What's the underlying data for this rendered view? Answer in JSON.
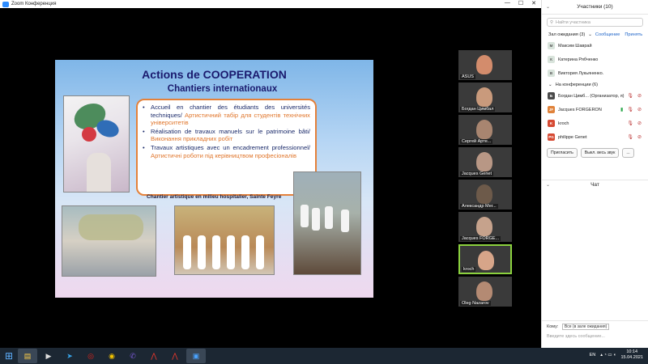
{
  "window": {
    "title": "Zoom Конференция",
    "minimize": "—",
    "maximize": "☐",
    "close": "✕"
  },
  "slide": {
    "title": "Actions de COOPERATION",
    "subtitle": "Chantiers internationaux",
    "bullets": [
      {
        "fr": "Accueil en chantier des étudiants des universités techniques/ ",
        "ua": "Артистичний табір для студентів технічних університетів"
      },
      {
        "fr": "Réalisation de travaux manuels sur le patrimoine bâti/",
        "ua": "Виконання прикладних робіт"
      },
      {
        "fr": "Travaux artistiques avec un encadrement professionnel/ ",
        "ua": "Артистичні роботи під керівництвом професіоналів"
      }
    ],
    "caption": "Chantier artistique en milieu hospitalier, Sainte Feyre"
  },
  "videos": [
    {
      "name": "ASUS"
    },
    {
      "name": "Богдан Цимбал"
    },
    {
      "name": "Сергей Арте..."
    },
    {
      "name": "Jacques Genet"
    },
    {
      "name": "Александр Мег..."
    },
    {
      "name": "Jacques FORGE..."
    },
    {
      "name": "kroch"
    },
    {
      "name": "Oleg Nazarov"
    }
  ],
  "participants": {
    "header": "Участники (10)",
    "search_placeholder": "Найти участника",
    "waiting": {
      "label": "Зал ожидания (3)",
      "message": "Сообщение",
      "admit": "Принять"
    },
    "waiting_list": [
      {
        "initial": "М",
        "name": "Максим Шаврай",
        "color": "#d9e4dc"
      },
      {
        "initial": "К",
        "name": "Катерина Рябченко",
        "color": "#d9e4dc"
      },
      {
        "initial": "В",
        "name": "Виктория Лукьяненко.",
        "color": "#d9e4dc"
      }
    ],
    "in_meeting_label": "На конференции (6)",
    "in_meeting": [
      {
        "initial": "Б",
        "name": "Богдан Цимб... (Организатор, я)",
        "color": "#4a4a4a"
      },
      {
        "initial": "JF",
        "name": "Jacques FORGERON",
        "color": "#e0823a"
      },
      {
        "initial": "K",
        "name": "kroch",
        "color": "#d64a33"
      },
      {
        "initial": "PG",
        "name": "philippe Genet",
        "color": "#d64a33"
      }
    ],
    "invite": "Пригласить",
    "mute_all": "Выкл. весь звук",
    "more": "..."
  },
  "chat": {
    "header": "Чат",
    "to_label": "Кому:",
    "to_value": "Все (в зале ожидания)",
    "placeholder": "Введите здесь сообщение..."
  },
  "taskbar": {
    "lang": "EN",
    "time": "10:14",
    "date": "15.04.2021"
  }
}
